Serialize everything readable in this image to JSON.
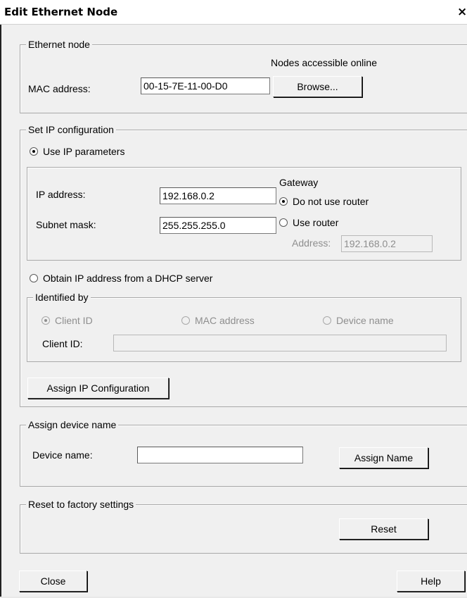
{
  "window": {
    "title": "Edit Ethernet Node",
    "close_glyph": "×"
  },
  "ethernet_node": {
    "legend": "Ethernet node",
    "online_label": "Nodes accessible online",
    "mac_label": "MAC address:",
    "mac_value": "00-15-7E-11-00-D0",
    "browse_label": "Browse..."
  },
  "ip_config": {
    "legend": "Set IP configuration",
    "use_ip_label": "Use IP parameters",
    "ip_label": "IP address:",
    "ip_value": "192.168.0.2",
    "subnet_label": "Subnet mask:",
    "subnet_value": "255.255.255.0",
    "gateway_label": "Gateway",
    "no_router_label": "Do not use router",
    "use_router_label": "Use router",
    "router_address_label": "Address:",
    "router_address_value": "192.168.0.2",
    "dhcp_label": "Obtain IP address from a DHCP server",
    "identified_by": {
      "legend": "Identified by",
      "client_id_option": "Client ID",
      "mac_option": "MAC address",
      "device_name_option": "Device name",
      "client_id_label": "Client ID:",
      "client_id_value": ""
    },
    "assign_label": "Assign IP Configuration"
  },
  "device_name": {
    "legend": "Assign device name",
    "label": "Device name:",
    "value": "",
    "assign_label": "Assign Name"
  },
  "factory": {
    "legend": "Reset to factory settings",
    "reset_label": "Reset"
  },
  "footer": {
    "close_label": "Close",
    "help_label": "Help"
  }
}
